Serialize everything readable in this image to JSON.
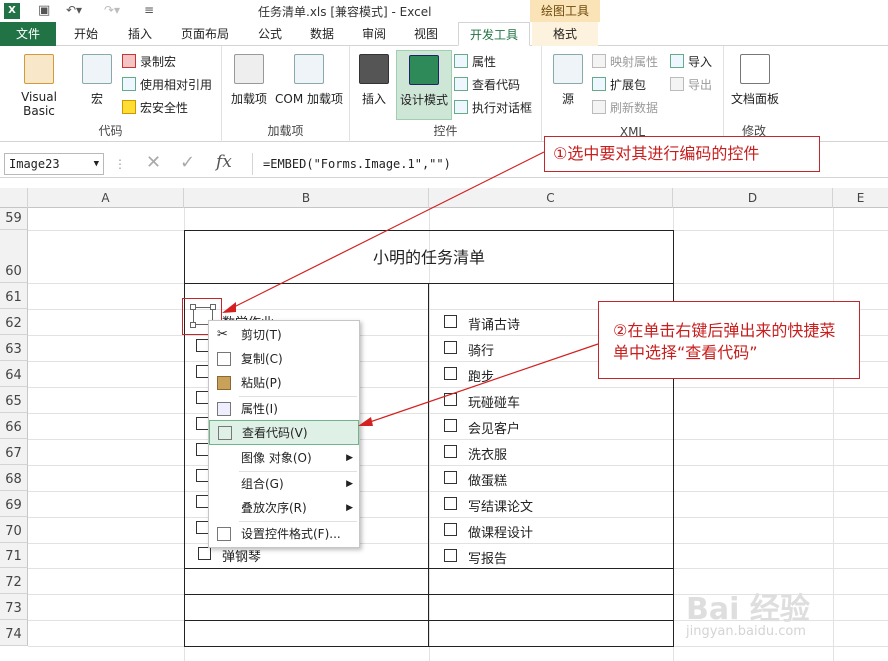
{
  "titlebar": {
    "title": "任务清单.xls  [兼容模式] - Excel",
    "context_tab": "绘图工具"
  },
  "tabs": [
    "文件",
    "开始",
    "插入",
    "页面布局",
    "公式",
    "数据",
    "审阅",
    "视图",
    "开发工具",
    "格式"
  ],
  "ribbon": {
    "groups": {
      "code": "代码",
      "addins": "加载项",
      "controls": "控件",
      "xml": "XML",
      "modify": "修改"
    },
    "vb": "Visual Basic",
    "macro": "宏",
    "record": "录制宏",
    "relative": "使用相对引用",
    "security": "宏安全性",
    "addin": "加载项",
    "com": "COM 加载项",
    "insert": "插入",
    "design": "设计模式",
    "props": "属性",
    "viewcode": "查看代码",
    "dialog": "执行对话框",
    "source": "源",
    "mapprops": "映射属性",
    "ext": "扩展包",
    "refresh": "刷新数据",
    "import": "导入",
    "export": "导出",
    "docpanel": "文档面板"
  },
  "formula_bar": {
    "name_box": "Image23",
    "fx": "fx",
    "formula": "=EMBED(\"Forms.Image.1\",\"\")"
  },
  "columns": [
    "A",
    "B",
    "C",
    "D",
    "E"
  ],
  "rows": [
    "59",
    "60",
    "61",
    "62",
    "63",
    "64",
    "65",
    "66",
    "67",
    "68",
    "69",
    "70",
    "71",
    "72",
    "73",
    "74"
  ],
  "table": {
    "title": "小明的任务清单",
    "col_b": [
      "数学作业",
      "",
      "",
      "",
      "",
      "",
      "",
      "",
      "",
      "弹钢琴"
    ],
    "col_c": [
      "背诵古诗",
      "骑行",
      "跑步",
      "玩碰碰车",
      "会见客户",
      "洗衣服",
      "做蛋糕",
      "写结课论文",
      "做课程设计",
      "写报告"
    ]
  },
  "context_menu": [
    "剪切(T)",
    "复制(C)",
    "粘贴(P)",
    "属性(I)",
    "查看代码(V)",
    "图像 对象(O)",
    "组合(G)",
    "叠放次序(R)",
    "设置控件格式(F)..."
  ],
  "annotations": {
    "note1": "①选中要对其进行编码的控件",
    "note2": "②在单击右键后弹出来的快捷菜单中选择“查看代码”"
  },
  "watermark": {
    "text": "Bai 经验",
    "url": "jingyan.baidu.com"
  },
  "colors": {
    "excel_green": "#217346",
    "accent_red": "#c81e1e"
  }
}
